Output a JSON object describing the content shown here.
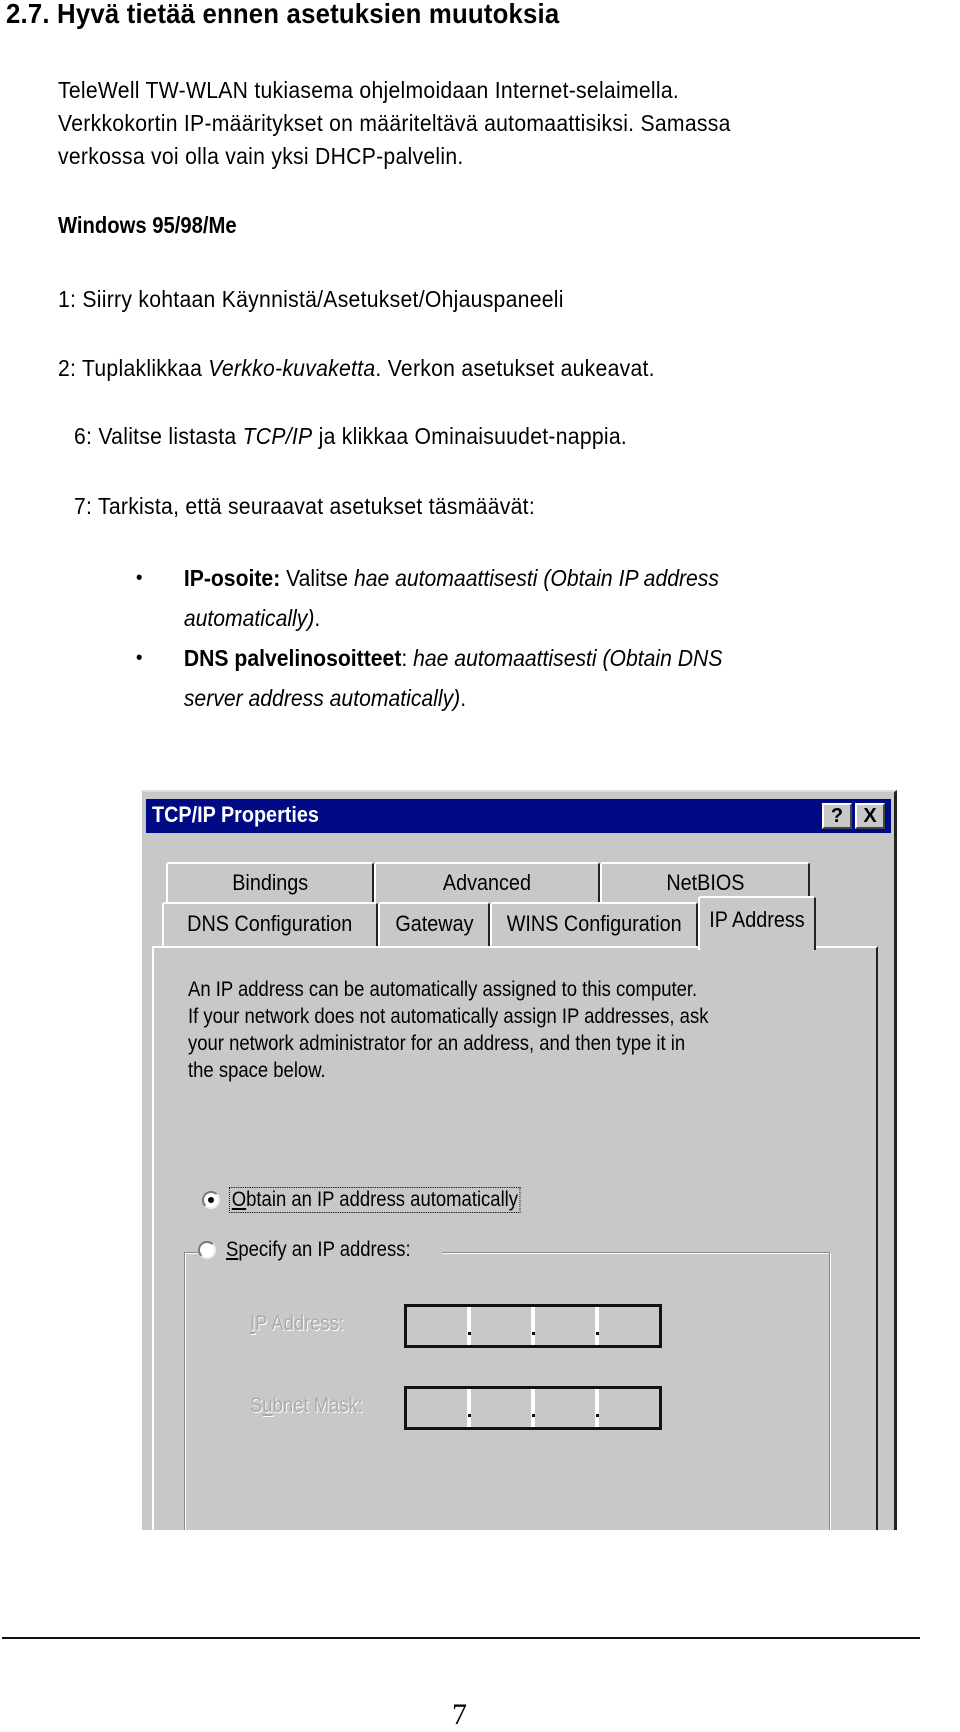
{
  "document": {
    "heading": "2.7. Hyvä tietää ennen asetuksien muutoksia",
    "intro_lines": [
      "TeleWell TW-WLAN tukiasema ohjelmoidaan Internet-selaimella.",
      "Verkkokortin IP-määritykset on määriteltävä automaattisiksi. Samassa",
      "verkossa voi olla vain yksi DHCP-palvelin."
    ],
    "subheading": "Windows 95/98/Me",
    "steps": {
      "s1": "1: Siirry kohtaan Käynnistä/Asetukset/Ohjauspaneeli",
      "s2_prefix": "2: Tuplaklikkaa ",
      "s2_italic": "Verkko-kuvaketta",
      "s2_suffix": ". Verkon asetukset aukeavat.",
      "s6_prefix": "6: Valitse listasta ",
      "s6_italic": "TCP/IP",
      "s6_suffix": " ja klikkaa Ominaisuudet-nappia.",
      "s7": "7: Tarkista, että seuraavat asetukset täsmäävät:"
    },
    "bullets": [
      {
        "bold": "IP-osoite:",
        "plain": " Valitse ",
        "italic_line1": "hae automaattisesti (Obtain IP address",
        "italic_line2": "automatically)",
        "end": "."
      },
      {
        "bold": "DNS palvelinosoitteet",
        "plain": ": ",
        "italic_line1": "hae automaattisesti (Obtain DNS",
        "italic_line2": "server address automatically)",
        "end": "."
      }
    ],
    "bullet_glyph": "•",
    "page_number": "7"
  },
  "dialog": {
    "title": "TCP/IP Properties",
    "help_button": "?",
    "close_button": "X",
    "tabs_row1": [
      "Bindings",
      "Advanced",
      "NetBIOS"
    ],
    "tabs_row2": [
      "DNS Configuration",
      "Gateway",
      "WINS Configuration",
      "IP Address"
    ],
    "active_tab": "IP Address",
    "description_lines": [
      "An IP address can be automatically assigned to this computer.",
      "If your network does not automatically assign IP addresses, ask",
      "your network administrator for an address, and then type it in",
      "the space below."
    ],
    "radio_obtain": {
      "label_ul": "O",
      "label_rest": "btain an IP address automatically",
      "checked": true
    },
    "radio_specify": {
      "label_ul": "S",
      "label_rest": "pecify an IP address:",
      "checked": false
    },
    "ip_address_label": {
      "ul": "I",
      "rest": "P Address:"
    },
    "subnet_mask_label": {
      "pre": "S",
      "ul": "u",
      "rest": "bnet Mask:"
    },
    "ip_address_value": [
      "",
      "",
      "",
      ""
    ],
    "subnet_mask_value": [
      "",
      "",
      "",
      ""
    ],
    "colors": {
      "titlebar": "#000a84",
      "face": "#c8c8c8"
    }
  }
}
